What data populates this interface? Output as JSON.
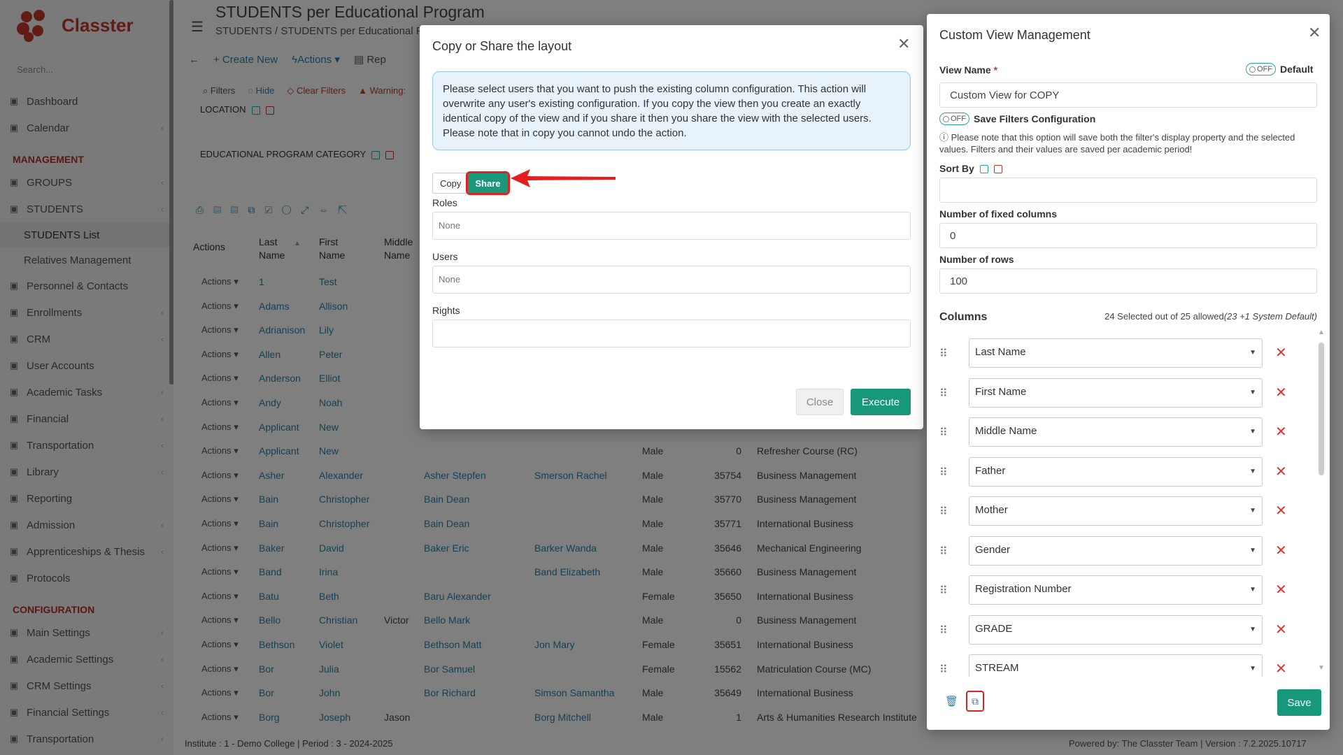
{
  "app": {
    "logo_text": "Classter",
    "search_placeholder": "Search..."
  },
  "sidebar": {
    "top_items": [
      "Dashboard",
      "Calendar"
    ],
    "section_management": "MANAGEMENT",
    "groups": "GROUPS",
    "students": "STUDENTS",
    "students_sub": [
      "STUDENTS List",
      "Relatives Management"
    ],
    "management_items": [
      "Personnel & Contacts",
      "Enrollments",
      "CRM",
      "User Accounts",
      "Academic Tasks",
      "Financial",
      "Transportation",
      "Library",
      "Reporting",
      "Admission",
      "Apprenticeships & Thesis",
      "Protocols"
    ],
    "section_configuration": "CONFIGURATION",
    "configuration_items": [
      "Main Settings",
      "Academic Settings",
      "CRM Settings",
      "Financial Settings",
      "Transportation"
    ]
  },
  "page": {
    "title": "STUDENTS per Educational Program",
    "breadcrumb": "STUDENTS  /  STUDENTS per Educational P",
    "toolbar": {
      "create_new": "+ Create New",
      "actions": "Actions ▾",
      "report": "Rep"
    },
    "filters": {
      "filters": "Filters",
      "hide": "Hide",
      "clear": "Clear Filters",
      "warning": "Warning:"
    },
    "filter_location": "LOCATION",
    "filter_program_category": "EDUCATIONAL PROGRAM CATEGORY",
    "grid_headers": {
      "actions": "Actions",
      "last_name": "Last Name",
      "first_name": "First Name",
      "middle_name": "Middle Name"
    },
    "rows": [
      {
        "a": "Actions ▾",
        "ln": "1",
        "fn": "Test",
        "mn": "",
        "f": "",
        "m": "",
        "g": "",
        "r": "",
        "p": ""
      },
      {
        "a": "Actions ▾",
        "ln": "Adams",
        "fn": "Allison",
        "mn": "",
        "f": "",
        "m": "",
        "g": "",
        "r": "",
        "p": ""
      },
      {
        "a": "Actions ▾",
        "ln": "Adrianison",
        "fn": "Lily",
        "mn": "",
        "f": "",
        "m": "",
        "g": "",
        "r": "",
        "p": ""
      },
      {
        "a": "Actions ▾",
        "ln": "Allen",
        "fn": "Peter",
        "mn": "",
        "f": "",
        "m": "",
        "g": "",
        "r": "",
        "p": ""
      },
      {
        "a": "Actions ▾",
        "ln": "Anderson",
        "fn": "Elliot",
        "mn": "",
        "f": "",
        "m": "",
        "g": "",
        "r": "",
        "p": ""
      },
      {
        "a": "Actions ▾",
        "ln": "Andy",
        "fn": "Noah",
        "mn": "",
        "f": "",
        "m": "",
        "g": "",
        "r": "",
        "p": ""
      },
      {
        "a": "Actions ▾",
        "ln": "Applicant",
        "fn": "New",
        "mn": "",
        "f": "",
        "m": "",
        "g": "",
        "r": "",
        "p": ""
      },
      {
        "a": "Actions ▾",
        "ln": "Applicant",
        "fn": "New",
        "mn": "",
        "f": "",
        "m": "",
        "g": "Male",
        "r": "0",
        "p": "Refresher Course (RC)"
      },
      {
        "a": "Actions ▾",
        "ln": "Asher",
        "fn": "Alexander",
        "mn": "",
        "f": "Asher Stepfen",
        "m": "Smerson Rachel",
        "g": "Male",
        "r": "35754",
        "p": "Business Management"
      },
      {
        "a": "Actions ▾",
        "ln": "Bain",
        "fn": "Christopher",
        "mn": "",
        "f": "Bain Dean",
        "m": "",
        "g": "Male",
        "r": "35770",
        "p": "Business Management"
      },
      {
        "a": "Actions ▾",
        "ln": "Bain",
        "fn": "Christopher",
        "mn": "",
        "f": "Bain Dean",
        "m": "",
        "g": "Male",
        "r": "35771",
        "p": "International Business"
      },
      {
        "a": "Actions ▾",
        "ln": "Baker",
        "fn": "David",
        "mn": "",
        "f": "Baker Eric",
        "m": "Barker Wanda",
        "g": "Male",
        "r": "35646",
        "p": "Mechanical Engineering"
      },
      {
        "a": "Actions ▾",
        "ln": "Band",
        "fn": "Irina",
        "mn": "",
        "f": "",
        "m": "Band Elizabeth",
        "g": "Male",
        "r": "35660",
        "p": "Business Management"
      },
      {
        "a": "Actions ▾",
        "ln": "Batu",
        "fn": "Beth",
        "mn": "",
        "f": "Baru Alexander",
        "m": "",
        "g": "Female",
        "r": "35650",
        "p": "International Business"
      },
      {
        "a": "Actions ▾",
        "ln": "Bello",
        "fn": "Christian",
        "mn": "Victor",
        "f": "Bello Mark",
        "m": "",
        "g": "Male",
        "r": "0",
        "p": "Business Management"
      },
      {
        "a": "Actions ▾",
        "ln": "Bethson",
        "fn": "Violet",
        "mn": "",
        "f": "Bethson Matt",
        "m": "Jon Mary",
        "g": "Female",
        "r": "35651",
        "p": "International Business"
      },
      {
        "a": "Actions ▾",
        "ln": "Bor",
        "fn": "Julia",
        "mn": "",
        "f": "Bor Samuel",
        "m": "",
        "g": "Female",
        "r": "15562",
        "p": "Matriculation Course (MC)"
      },
      {
        "a": "Actions ▾",
        "ln": "Bor",
        "fn": "John",
        "mn": "",
        "f": "Bor Richard",
        "m": "Simson Samantha",
        "g": "Male",
        "r": "35649",
        "p": "International Business"
      },
      {
        "a": "Actions ▾",
        "ln": "Borg",
        "fn": "Joseph",
        "mn": "Jason",
        "f": "",
        "m": "Borg Mitchell",
        "g": "Male",
        "r": "1",
        "p": "Arts & Humanities Research Institute"
      }
    ],
    "footer_left": "Institute : 1 - Demo College  |  Period : 3 - 2024-2025",
    "footer_right": "Powered by: The Classter Team  |  Version : 7.2.2025.10717"
  },
  "share_modal": {
    "title": "Copy or Share the layout",
    "info": "Please select users that you want to push the existing column configuration. This action will overwrite any user's existing configuration. If you copy the view then you create an exactly identical copy of the view and if you share it then you share the view with the selected users. Please note that in copy you cannot undo the action.",
    "copy_label": "Copy",
    "share_label": "Share",
    "roles_label": "Roles",
    "roles_value": "None",
    "users_label": "Users",
    "users_value": "None",
    "rights_label": "Rights",
    "close_label": "Close",
    "execute_label": "Execute"
  },
  "custom_view": {
    "title": "Custom View Management",
    "view_name_label": "View Name",
    "required_mark": "*",
    "default_toggle": "OFF",
    "default_label": "Default",
    "view_name_value": "Custom View for COPY",
    "save_filters_toggle": "OFF",
    "save_filters_label": "Save Filters Configuration",
    "note": "Please note that this option will save both the filter's display property and the selected values. Filters and their values are saved per academic period!",
    "sort_by_label": "Sort By",
    "fixed_columns_label": "Number of fixed columns",
    "fixed_columns_value": "0",
    "rows_label": "Number of rows",
    "rows_value": "100",
    "columns_label": "Columns",
    "columns_count": "24 Selected out of 25 allowed",
    "columns_count_note": "(23 +1 System Default)",
    "columns": [
      "Last Name",
      "First Name",
      "Middle Name",
      "Father",
      "Mother",
      "Gender",
      "Registration Number",
      "GRADE",
      "STREAM"
    ],
    "save_label": "Save"
  },
  "colors": {
    "accent": "#17987a",
    "brand": "#c0392b",
    "link": "#2f7ea8",
    "highlight": "#dd2222"
  }
}
